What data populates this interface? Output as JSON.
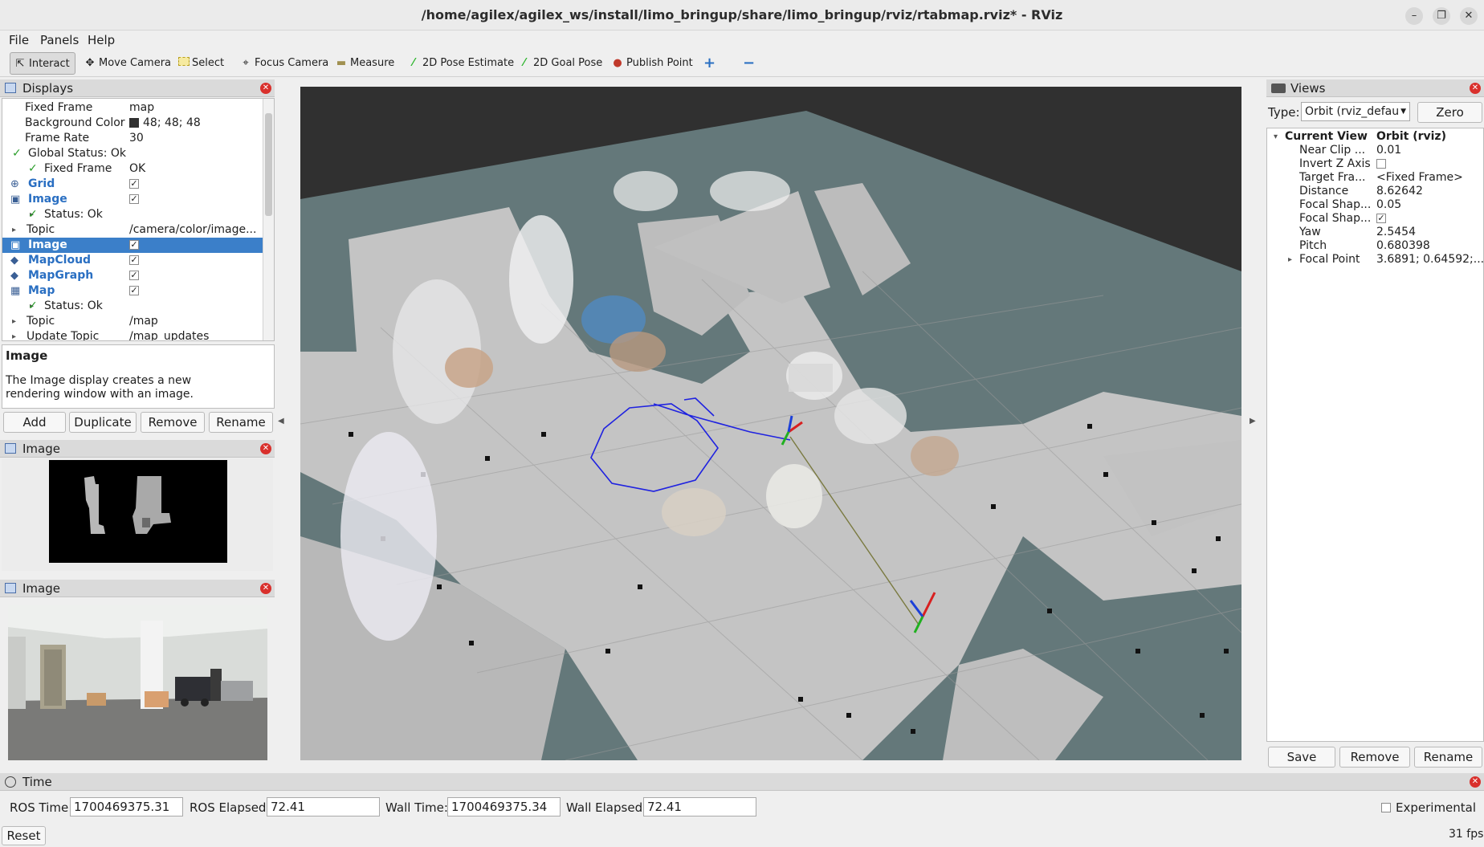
{
  "window": {
    "title": "/home/agilex/agilex_ws/install/limo_bringup/share/limo_bringup/rviz/rtabmap.rviz* - RViz",
    "controls": [
      "minimize",
      "restore",
      "close"
    ]
  },
  "menu": [
    "File",
    "Panels",
    "Help"
  ],
  "toolbar": {
    "tools": [
      {
        "label": "Interact",
        "icon": "cursor-icon",
        "active": true
      },
      {
        "label": "Move Camera",
        "icon": "move-icon"
      },
      {
        "label": "Select",
        "icon": "select-box-icon"
      },
      {
        "label": "Focus Camera",
        "icon": "crosshair-icon"
      },
      {
        "label": "Measure",
        "icon": "ruler-icon"
      },
      {
        "label": "2D Pose Estimate",
        "icon": "green-arrow-icon"
      },
      {
        "label": "2D Goal Pose",
        "icon": "green-arrow-icon"
      },
      {
        "label": "Publish Point",
        "icon": "map-pin-icon"
      }
    ],
    "add_symbol": "+",
    "remove_symbol": "−"
  },
  "displays": {
    "title": "Displays",
    "rows": [
      {
        "key": "Fixed Frame",
        "value": "map"
      },
      {
        "key": "Background Color",
        "value": "48; 48; 48"
      },
      {
        "key": "Frame Rate",
        "value": "30"
      },
      {
        "key": "Global Status: Ok",
        "value": ""
      },
      {
        "key": "Fixed Frame",
        "value": "OK"
      },
      {
        "key": "Grid",
        "value": "✓"
      },
      {
        "key": "Image",
        "value": "✓"
      },
      {
        "key": "Status: Ok",
        "value": ""
      },
      {
        "key": "Topic",
        "value": "/camera/color/image..."
      },
      {
        "key": "Image",
        "value": "✓"
      },
      {
        "key": "MapCloud",
        "value": "✓"
      },
      {
        "key": "MapGraph",
        "value": "✓"
      },
      {
        "key": "Map",
        "value": "✓"
      },
      {
        "key": "Status: Ok",
        "value": ""
      },
      {
        "key": "Topic",
        "value": "/map"
      },
      {
        "key": "Update Topic",
        "value": "/map_updates"
      }
    ],
    "description_title": "Image",
    "description_text": "The Image display creates a new rendering window with an image.",
    "buttons": [
      "Add",
      "Duplicate",
      "Remove",
      "Rename"
    ]
  },
  "image_panels": [
    {
      "title": "Image"
    },
    {
      "title": "Image"
    }
  ],
  "views": {
    "title": "Views",
    "type_label": "Type:",
    "type_value": "Orbit (rviz_defau",
    "zero_label": "Zero",
    "rows": [
      {
        "key": "Current View",
        "value": "Orbit (rviz)"
      },
      {
        "key": "Near Clip ...",
        "value": "0.01"
      },
      {
        "key": "Invert Z Axis",
        "value": ""
      },
      {
        "key": "Target Fra...",
        "value": "<Fixed Frame>"
      },
      {
        "key": "Distance",
        "value": "8.62642"
      },
      {
        "key": "Focal Shap...",
        "value": "0.05"
      },
      {
        "key": "Focal Shap...",
        "value": "✓"
      },
      {
        "key": "Yaw",
        "value": "2.5454"
      },
      {
        "key": "Pitch",
        "value": "0.680398"
      },
      {
        "key": "Focal Point",
        "value": "3.6891; 0.64592;..."
      }
    ],
    "buttons": [
      "Save",
      "Remove",
      "Rename"
    ]
  },
  "time": {
    "title": "Time",
    "ros_time_label": "ROS Time:",
    "ros_time": "1700469375.31",
    "ros_elapsed_label": "ROS Elapsed:",
    "ros_elapsed": "72.41",
    "wall_time_label": "Wall Time:",
    "wall_time": "1700469375.34",
    "wall_elapsed_label": "Wall Elapsed:",
    "wall_elapsed": "72.41",
    "experimental_label": "Experimental",
    "reset_label": "Reset",
    "fps": "31 fps"
  },
  "colors": {
    "background": "#303030",
    "floor": "#c4c4c4",
    "unknown": "#64787a",
    "graph": "#1f22e0",
    "selection": "#3b7fc9"
  }
}
